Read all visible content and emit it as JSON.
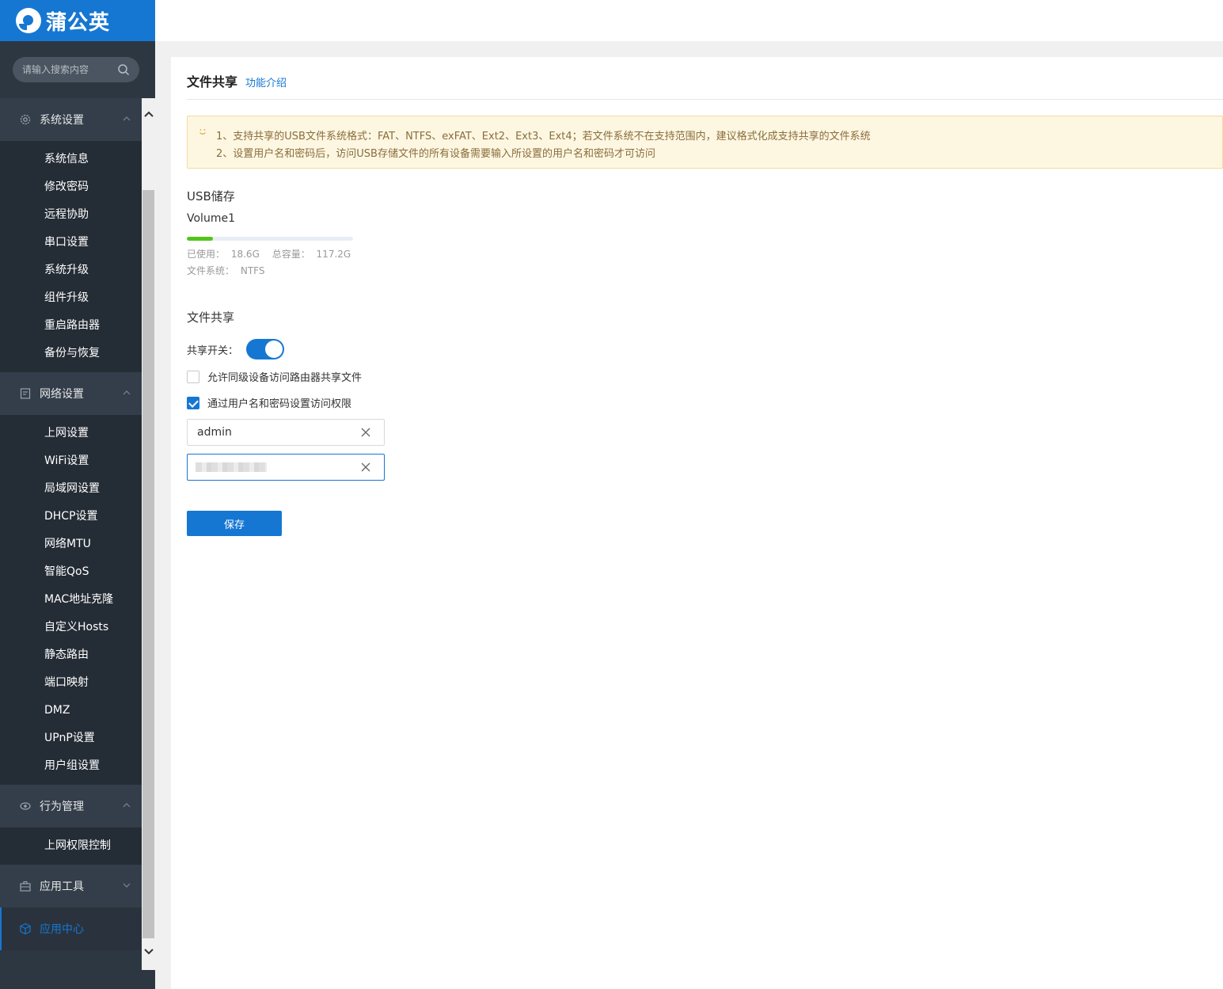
{
  "brand": {
    "name": "蒲公英",
    "color": "#1677d2"
  },
  "search": {
    "placeholder": "请输入搜索内容",
    "icon": "search-icon"
  },
  "sidebar": {
    "groups": [
      {
        "label": "系统设置",
        "icon": "gear-icon",
        "expanded": true,
        "items": [
          "系统信息",
          "修改密码",
          "远程协助",
          "串口设置",
          "系统升级",
          "组件升级",
          "重启路由器",
          "备份与恢复"
        ]
      },
      {
        "label": "网络设置",
        "icon": "document-icon",
        "expanded": true,
        "items": [
          "上网设置",
          "WiFi设置",
          "局域网设置",
          "DHCP设置",
          "网络MTU",
          "智能QoS",
          "MAC地址克隆",
          "自定义Hosts",
          "静态路由",
          "端口映射",
          "DMZ",
          "UPnP设置",
          "用户组设置"
        ]
      },
      {
        "label": "行为管理",
        "icon": "eye-icon",
        "expanded": true,
        "items": [
          "上网权限控制"
        ]
      },
      {
        "label": "应用工具",
        "icon": "briefcase-icon",
        "expanded": false,
        "items": []
      },
      {
        "label": "应用中心",
        "icon": "cube-icon",
        "active": true,
        "items": []
      }
    ]
  },
  "page": {
    "title": "文件共享",
    "intro_link": "功能介绍",
    "notice": {
      "line1": "1、支持共享的USB文件系统格式：FAT、NTFS、exFAT、Ext2、Ext3、Ext4；若文件系统不在支持范围内，建议格式化成支持共享的文件系统",
      "line2": "2、设置用户名和密码后，访问USB存储文件的所有设备需要输入所设置的用户名和密码才可访问"
    },
    "usb": {
      "section_title": "USB储存",
      "volume": "Volume1",
      "used_fraction": 0.159,
      "used_label": "已使用：",
      "used_value": "18.6G",
      "total_label": "总容量：",
      "total_value": "117.2G",
      "fs_label": "文件系统：",
      "fs_value": "NTFS"
    },
    "share": {
      "section_title": "文件共享",
      "switch_label": "共享开关：",
      "switch_on": true,
      "allow_peer_label": "允许同级设备访问路由器共享文件",
      "allow_peer_checked": false,
      "auth_label": "通过用户名和密码设置访问权限",
      "auth_checked": true,
      "username": "admin",
      "password_masked": true
    },
    "save_label": "保存"
  }
}
